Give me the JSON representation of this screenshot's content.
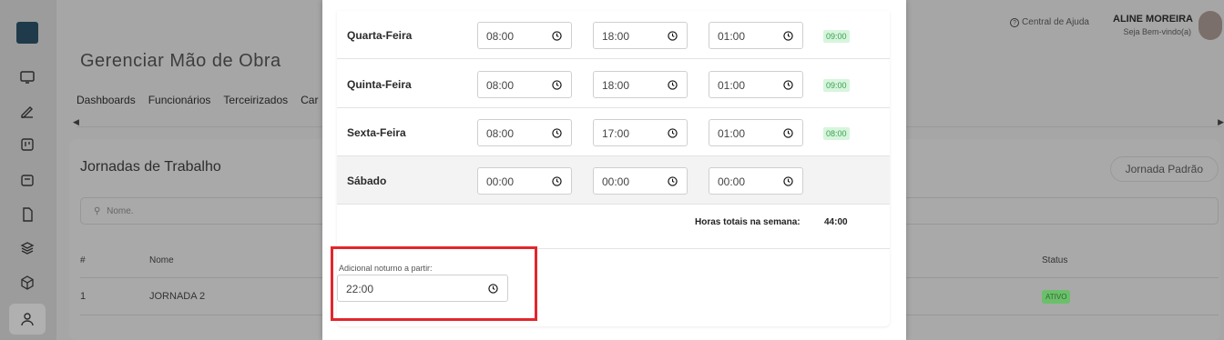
{
  "header": {
    "help_label": "Central de Ajuda",
    "user_name": "ALINE MOREIRA",
    "user_greeting": "Seja Bem-vindo(a)"
  },
  "sidebar": {
    "icons": [
      "monitor-icon",
      "pen-icon",
      "board-icon",
      "calendar-box-icon",
      "file-icon",
      "layers-icon",
      "cube-icon",
      "user-icon"
    ]
  },
  "page": {
    "title": "Gerenciar Mão de Obra",
    "tabs": [
      "Dashboards",
      "Funcionários",
      "Terceirizados",
      "Car"
    ],
    "card_title": "Jornadas de Trabalho",
    "default_button": "Jornada Padrão",
    "search_placeholder": "Nome.",
    "columns": {
      "hash": "#",
      "name": "Nome",
      "status": "Status"
    },
    "rows": [
      {
        "num": "1",
        "name": "JORNADA 2",
        "status": "ATIVO"
      }
    ]
  },
  "modal": {
    "days": [
      {
        "day": "Quarta-Feira",
        "start": "08:00",
        "end": "18:00",
        "break": "01:00",
        "hours": "09:00"
      },
      {
        "day": "Quinta-Feira",
        "start": "08:00",
        "end": "18:00",
        "break": "01:00",
        "hours": "09:00"
      },
      {
        "day": "Sexta-Feira",
        "start": "08:00",
        "end": "17:00",
        "break": "01:00",
        "hours": "08:00"
      },
      {
        "day": "Sábado",
        "start": "00:00",
        "end": "00:00",
        "break": "00:00",
        "hours": ""
      }
    ],
    "total_label": "Horas totais na semana:",
    "total_value": "44:00",
    "night_label": "Adicional noturno a partir:",
    "night_value": "22:00"
  },
  "colors": {
    "highlight": "#e3262b",
    "hours_badge_bg": "#d7f5dd",
    "hours_badge_text": "#3aa04e",
    "status_badge": "#6bbf6b"
  }
}
